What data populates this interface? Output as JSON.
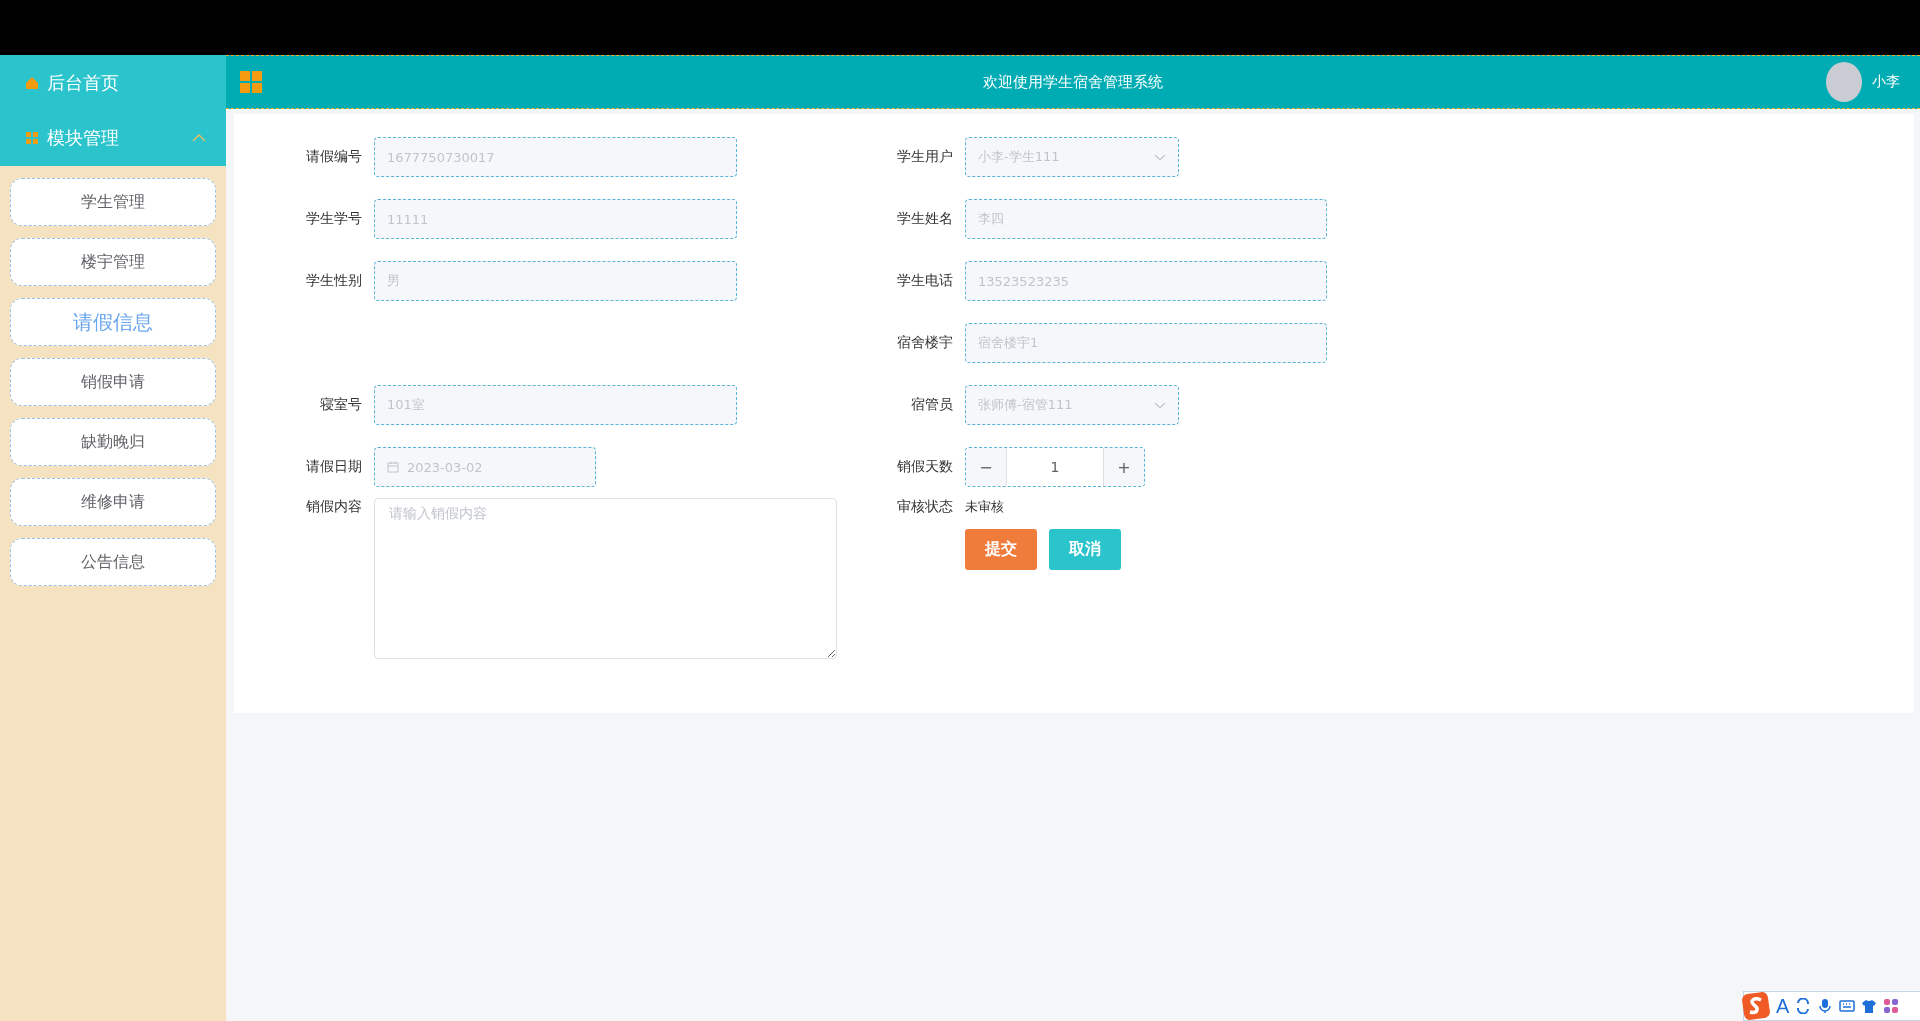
{
  "sidebar": {
    "nav": [
      {
        "label": "后台首页",
        "kind": "home"
      },
      {
        "label": "模块管理",
        "kind": "group",
        "expanded": true
      }
    ],
    "items": [
      {
        "label": "学生管理",
        "selected": false
      },
      {
        "label": "楼宇管理",
        "selected": false
      },
      {
        "label": "请假信息",
        "selected": true
      },
      {
        "label": "销假申请",
        "selected": false
      },
      {
        "label": "缺勤晚归",
        "selected": false
      },
      {
        "label": "维修申请",
        "selected": false
      },
      {
        "label": "公告信息",
        "selected": false
      }
    ]
  },
  "header": {
    "title": "欢迎使用学生宿舍管理系统",
    "user": "小李"
  },
  "form": {
    "rows": [
      {
        "left": {
          "label": "请假编号",
          "kind": "text",
          "value": "1677750730017",
          "disabled": true
        },
        "right": {
          "label": "学生用户",
          "kind": "select",
          "value": "小李-学生111",
          "disabled": true
        }
      },
      {
        "left": {
          "label": "学生学号",
          "kind": "text",
          "value": "11111",
          "disabled": true
        },
        "right": {
          "label": "学生姓名",
          "kind": "text",
          "value": "李四",
          "disabled": true
        }
      },
      {
        "left": {
          "label": "学生性别",
          "kind": "text",
          "value": "男",
          "disabled": true
        },
        "right": {
          "label": "学生电话",
          "kind": "text",
          "value": "13523523235",
          "disabled": true
        }
      },
      {
        "right": {
          "label": "宿舍楼宇",
          "kind": "text",
          "value": "宿舍楼宇1",
          "disabled": true
        }
      },
      {
        "left": {
          "label": "寝室号",
          "kind": "text",
          "value": "101室",
          "disabled": true
        },
        "right": {
          "label": "宿管员",
          "kind": "select",
          "value": "张师傅-宿管111",
          "disabled": true
        }
      },
      {
        "left": {
          "label": "请假日期",
          "kind": "date",
          "value": "2023-03-02",
          "disabled": true
        },
        "right": {
          "label": "销假天数",
          "kind": "number",
          "value": "1",
          "minus": "−",
          "plus": "+"
        }
      }
    ],
    "content": {
      "label": "销假内容",
      "placeholder": "请输入销假内容"
    },
    "status": {
      "label": "审核状态",
      "value": "未审核"
    },
    "buttons": [
      {
        "label": "提交",
        "kind": "primary"
      },
      {
        "label": "取消",
        "kind": "cancel"
      }
    ]
  },
  "ime_toolbar": {
    "mode": "A"
  }
}
